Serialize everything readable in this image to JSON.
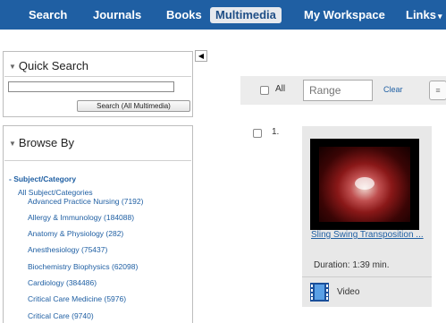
{
  "nav": {
    "items": [
      "Search",
      "Journals",
      "Books",
      "Multimedia",
      "My Workspace",
      "Links"
    ],
    "active": "Multimedia"
  },
  "collapse_icon": "left-triangle",
  "quick_search": {
    "title": "Quick Search",
    "input_value": "",
    "button_label": "Search (All Multimedia)"
  },
  "browse": {
    "title": "Browse By",
    "subject_label": "- Subject/Category",
    "all_label": "All Subject/Categories",
    "categories": [
      "Advanced Practice Nursing (7192)",
      "Allergy & Immunology (184088)",
      "Anatomy & Physiology (282)",
      "Anesthesiology (75437)",
      "Biochemistry Biophysics (62098)",
      "Cardiology (384486)",
      "Critical Care Medicine (5976)",
      "Critical Care (9740)"
    ]
  },
  "toolbar": {
    "all_label": "All",
    "range_placeholder": "Range",
    "clear_label": "Clear"
  },
  "result": {
    "number": "1.",
    "title": "Sling Swing Transposition ...",
    "duration": "Duration: 1:39 min.",
    "type_label": "Video",
    "type_icon": "film-strip-icon"
  },
  "colors": {
    "nav_bg": "#1f5fa3",
    "link": "#1f5fa3",
    "card_bg": "#e8e8e8"
  }
}
